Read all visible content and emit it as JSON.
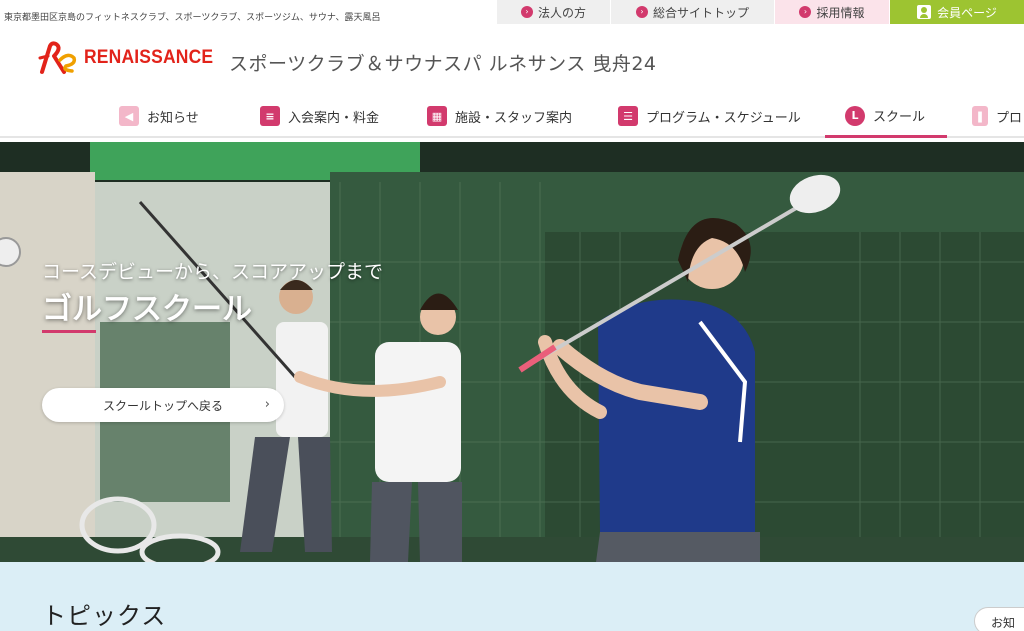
{
  "utility": {
    "description": "東京都墨田区京島のフィットネスクラブ、スポーツクラブ、スポーツジム、サウナ、露天風呂",
    "links": [
      {
        "label": "法人の方",
        "icon": "arrow-circle-icon"
      },
      {
        "label": "総合サイトトップ",
        "icon": "arrow-circle-icon"
      },
      {
        "label": "採用情報",
        "icon": "arrow-circle-icon"
      },
      {
        "label": "会員ページ",
        "icon": "member-card-icon"
      }
    ]
  },
  "header": {
    "logo_text": "RENAISSANCE",
    "club_name": "スポーツクラブ＆サウナスパ ルネサンス 曳舟24"
  },
  "nav": {
    "items": [
      {
        "label": "お知らせ",
        "icon": "megaphone-icon"
      },
      {
        "label": "入会案内・料金",
        "icon": "document-icon"
      },
      {
        "label": "施設・スタッフ案内",
        "icon": "building-icon"
      },
      {
        "label": "プログラム・スケジュール",
        "icon": "list-icon"
      },
      {
        "label": "スクール",
        "icon": "clock-icon",
        "active": true
      },
      {
        "label": "プロ",
        "icon": "bookmark-icon"
      }
    ]
  },
  "hero": {
    "subtitle": "コースデビューから、スコアアップまで",
    "title": "ゴルフスクール",
    "back_button": "スクールトップへ戻る"
  },
  "topics": {
    "title": "トピックス",
    "notice_button": "お知"
  },
  "colors": {
    "accent": "#d23a6d",
    "member": "#9dc431",
    "topics_bg": "#dbeef6",
    "logo_red": "#e2231a"
  }
}
